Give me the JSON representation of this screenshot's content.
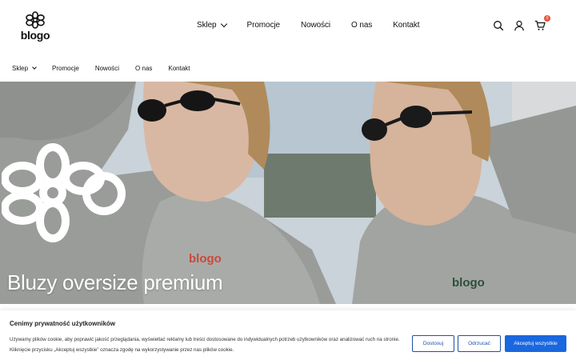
{
  "header": {
    "logo_text": "blogo",
    "nav": [
      {
        "label": "Sklep",
        "has_dropdown": true
      },
      {
        "label": "Promocje"
      },
      {
        "label": "Nowości"
      },
      {
        "label": "O nas"
      },
      {
        "label": "Kontakt"
      }
    ],
    "icons": [
      "search-icon",
      "user-icon",
      "cart-icon"
    ],
    "cart_count": "0"
  },
  "sub_nav": [
    {
      "label": "Sklep",
      "has_dropdown": true
    },
    {
      "label": "Promocje"
    },
    {
      "label": "Nowości"
    },
    {
      "label": "O nas"
    },
    {
      "label": "Kontakt"
    }
  ],
  "hero": {
    "title": "Bluzy oversize premium",
    "hoodie_print_left": "blogo",
    "hoodie_print_right": "blogo"
  },
  "cookie": {
    "title": "Cenimy prywatność użytkowników",
    "text": "Używamy plików cookie, aby poprawić jakość przeglądania, wyświetlać reklamy lub treści dostosowane do indywidualnych potrzeb użytkowników oraz analizować ruch na stronie. Kliknięcie przycisku „Akceptuj wszystkie” oznacza zgodę na wykorzystywanie przez nas plików cookie.",
    "buttons": {
      "customize": "Dostosuj",
      "reject": "Odrzucać",
      "accept": "Akceptuj wszystkie"
    }
  },
  "colors": {
    "accent": "#1a67e0",
    "outline": "#1f4fa8",
    "badge": "#e8543a"
  }
}
